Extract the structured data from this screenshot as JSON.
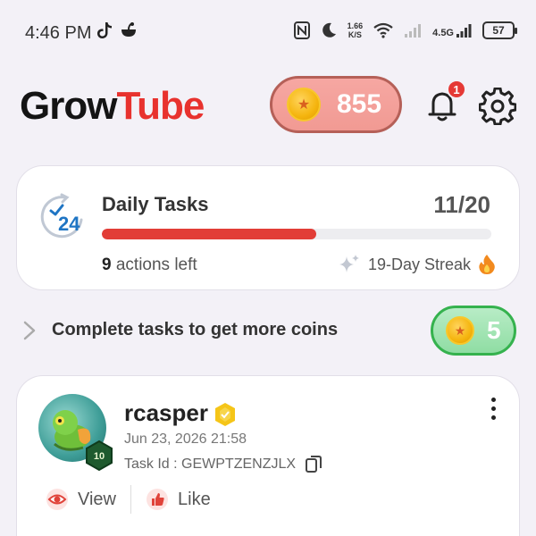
{
  "status_bar": {
    "time": "4:46 PM",
    "net_speed_value": "1.66",
    "net_speed_unit": "K/S",
    "network_type": "4.5G",
    "battery": "57"
  },
  "header": {
    "logo_part1": "Grow",
    "logo_part2": "Tube",
    "coins": "855",
    "notification_count": "1"
  },
  "daily_tasks": {
    "title": "Daily Tasks",
    "count": "11/20",
    "progress": 0.55,
    "actions_num": "9",
    "actions_label": "actions left",
    "streak": "19-Day Streak",
    "clock_number": "24"
  },
  "promo": {
    "text": "Complete tasks to get more coins",
    "reward": "5"
  },
  "post": {
    "username": "rcasper",
    "date": "Jun 23, 2026 21:58",
    "task_id": "Task Id : GEWPTZENZJLX",
    "level": "10",
    "view_label": "View",
    "like_label": "Like"
  },
  "colors": {
    "brand_red": "#e8322e",
    "coin_pill_bg": "#f19a93",
    "reward_pill_border": "#35b24e",
    "progress_fill": "#e23d37"
  }
}
